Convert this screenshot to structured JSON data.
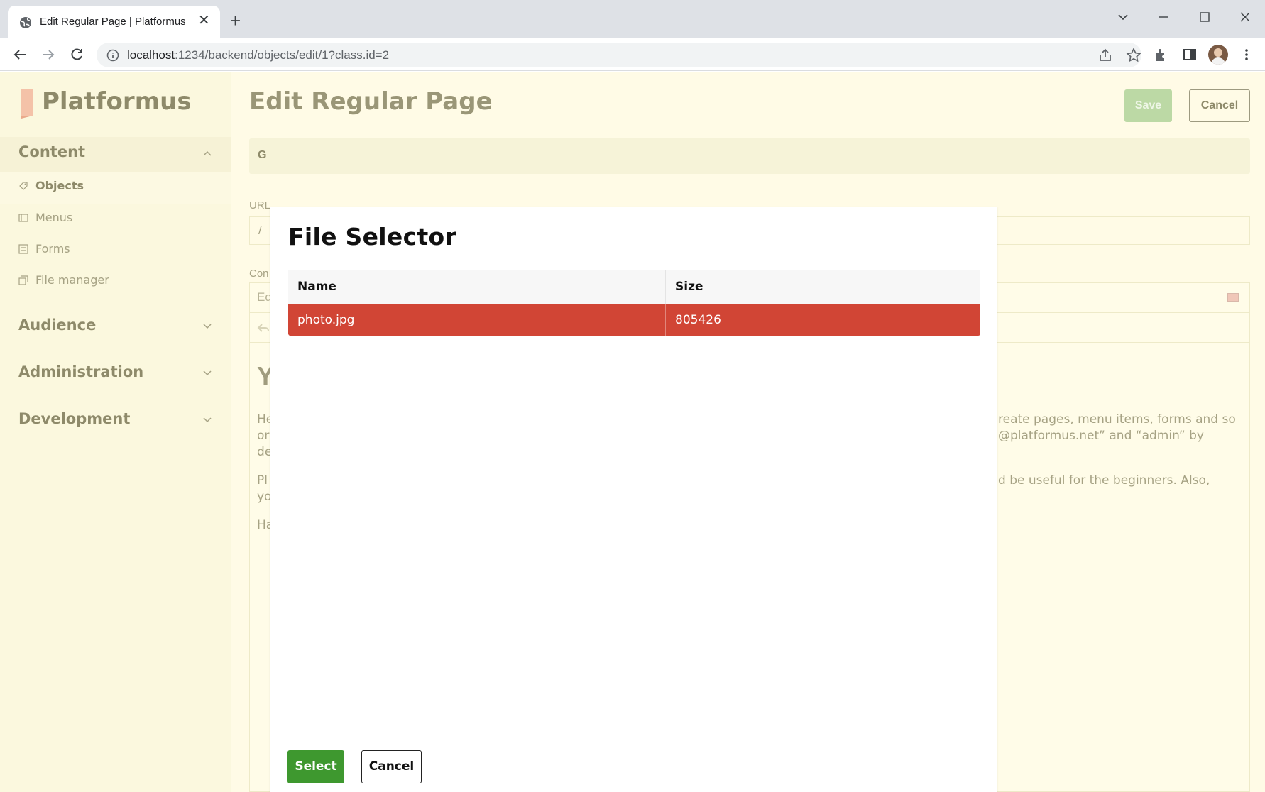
{
  "browser": {
    "tab_title": "Edit Regular Page | Platformus",
    "url_host": "localhost",
    "url_rest": ":1234/backend/objects/edit/1?class.id=2"
  },
  "sidebar": {
    "brand": "Platformus",
    "sections": [
      {
        "label": "Content",
        "expanded": true
      },
      {
        "label": "Audience",
        "expanded": false
      },
      {
        "label": "Administration",
        "expanded": false
      },
      {
        "label": "Development",
        "expanded": false
      }
    ],
    "content_items": [
      {
        "label": "Objects",
        "icon": "tag-icon",
        "active": true
      },
      {
        "label": "Menus",
        "icon": "menu-icon",
        "active": false
      },
      {
        "label": "Forms",
        "icon": "form-icon",
        "active": false
      },
      {
        "label": "File manager",
        "icon": "file-manager-icon",
        "active": false
      }
    ]
  },
  "main": {
    "title": "Edit Regular Page",
    "save_label": "Save",
    "cancel_label": "Cancel",
    "tab_fragment": "G",
    "url_label": "URL",
    "url_value": "/",
    "content_label": "Con",
    "editor_top_fragment": "Ed",
    "editor_heading_fragment": "Y",
    "editor_fragments": {
      "left": [
        "He",
        "or",
        "de",
        "Pl",
        "yo",
        "Ha"
      ],
      "right": [
        "reate pages, menu items, forms and so",
        "@platformus.net” and “admin” by",
        "d be useful for the beginners. Also,"
      ]
    }
  },
  "modal": {
    "title": "File Selector",
    "columns": [
      "Name",
      "Size"
    ],
    "rows": [
      {
        "name": "photo.jpg",
        "size": "805426",
        "selected": true
      }
    ],
    "select_label": "Select",
    "cancel_label": "Cancel",
    "colors": {
      "selected_row": "#d14535",
      "select_button": "#3e982f"
    }
  }
}
